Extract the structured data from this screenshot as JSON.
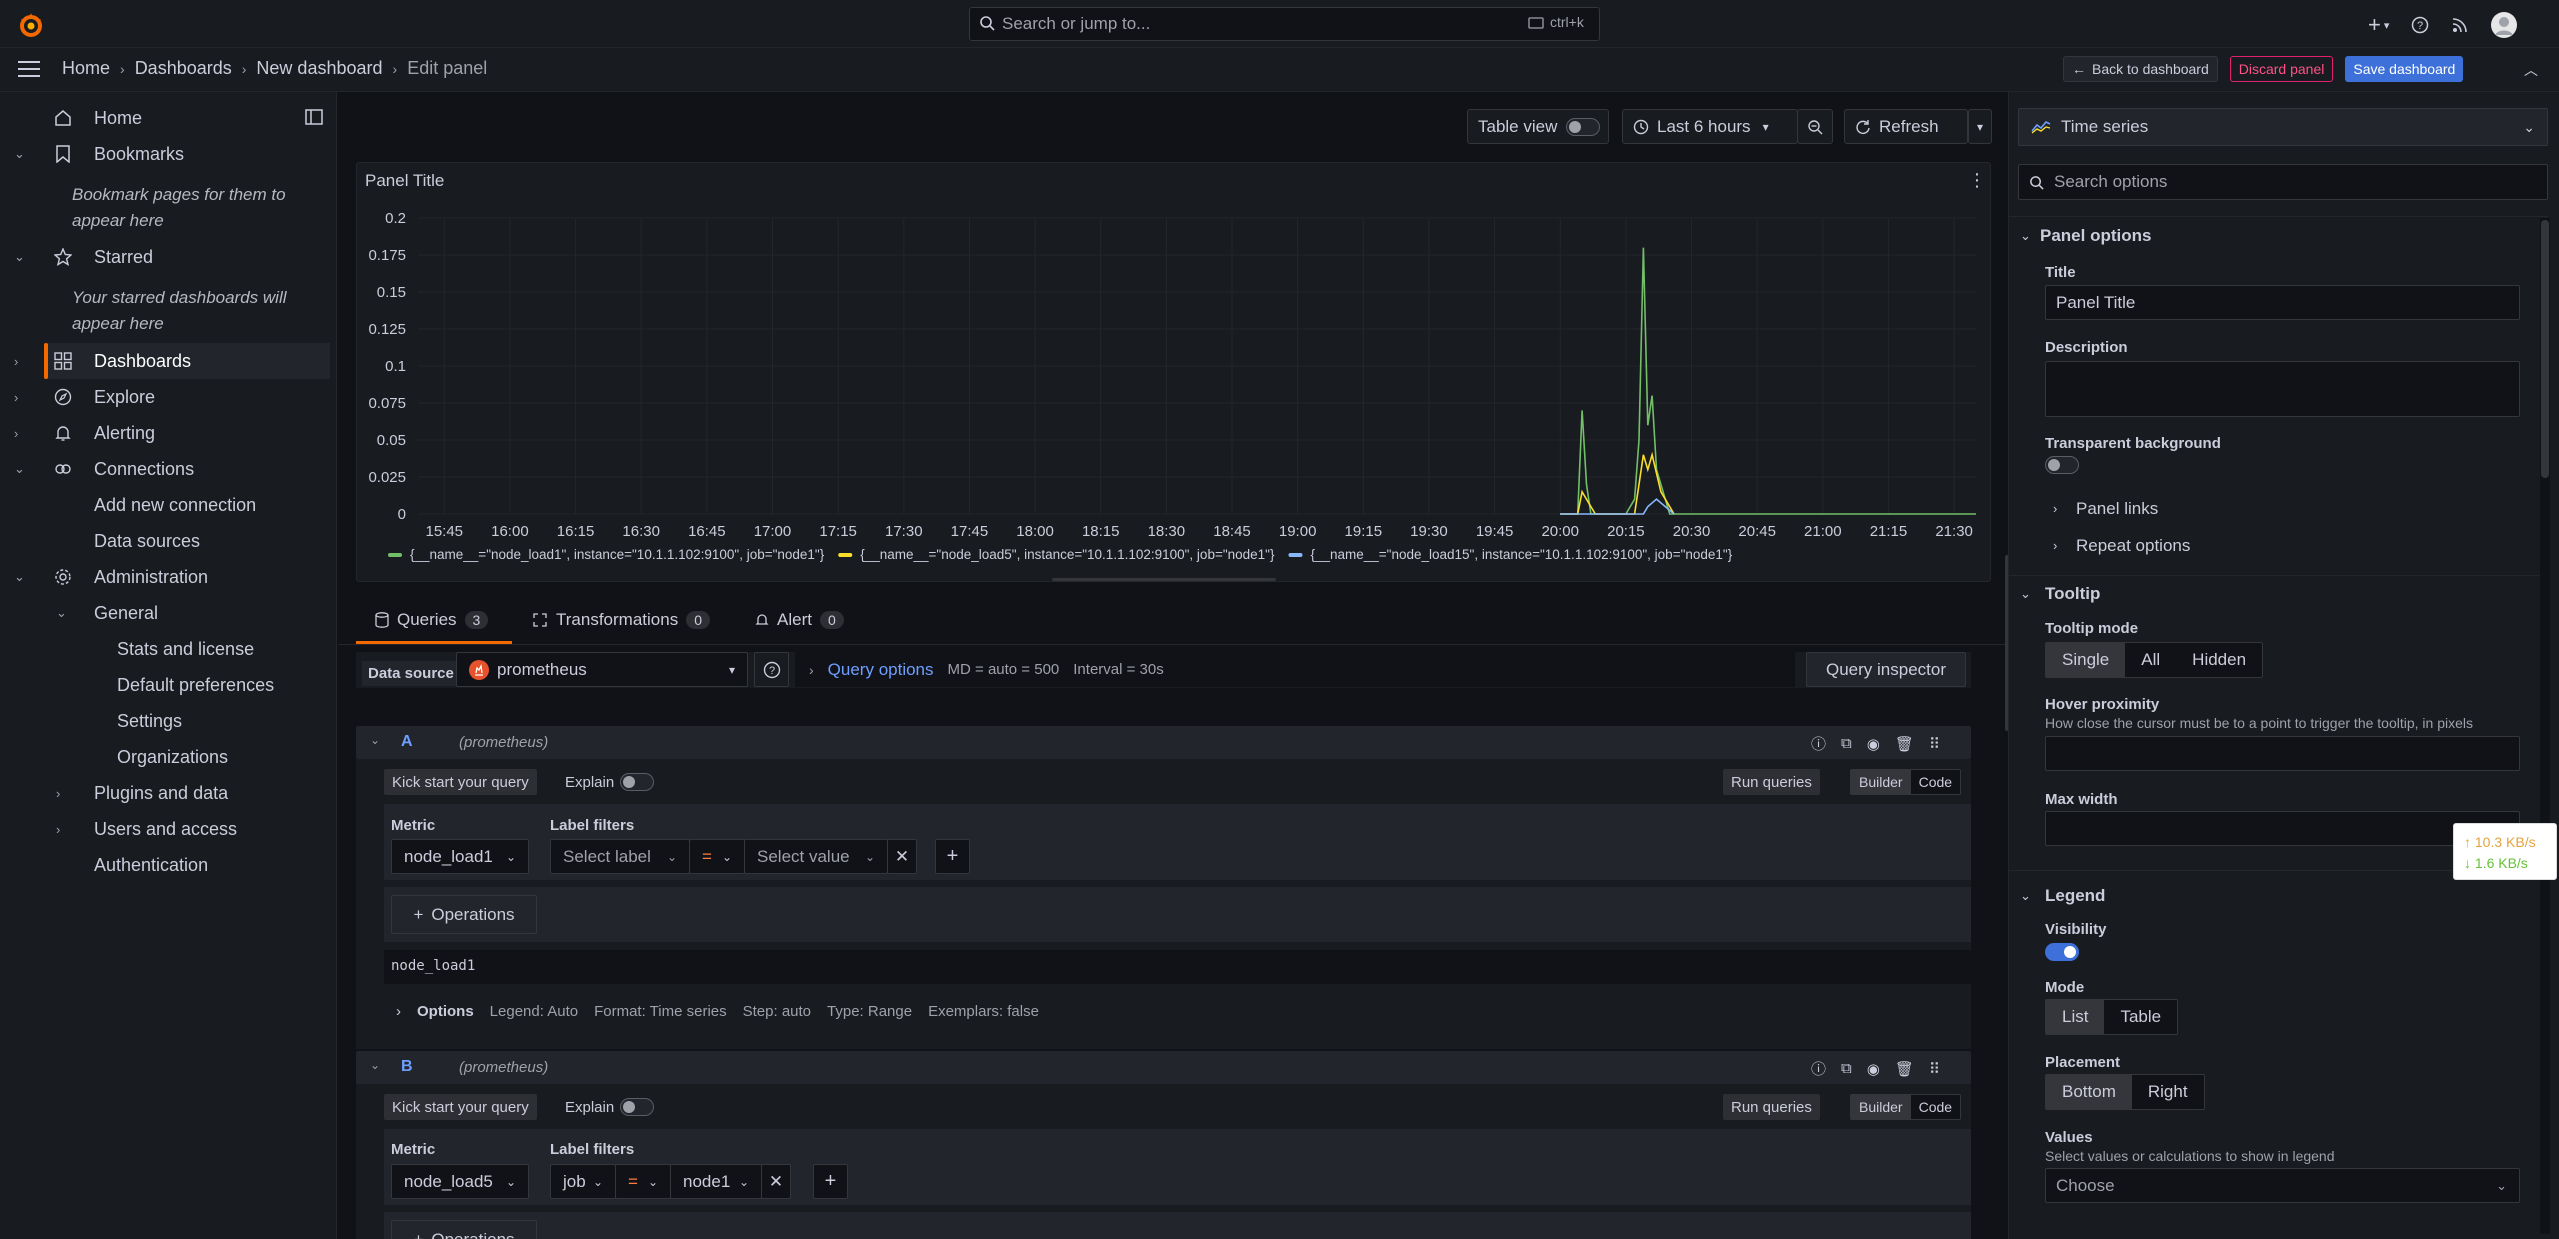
{
  "topbar": {
    "search_placeholder": "Search or jump to...",
    "search_shortcut": "ctrl+k"
  },
  "breadcrumbs": [
    "Home",
    "Dashboards",
    "New dashboard",
    "Edit panel"
  ],
  "actions": {
    "back": "Back to dashboard",
    "discard": "Discard panel",
    "save": "Save dashboard"
  },
  "sidebar": {
    "home": "Home",
    "bookmarks": "Bookmarks",
    "bookmarks_hint_1": "Bookmark pages for them to",
    "bookmarks_hint_2": "appear here",
    "starred": "Starred",
    "starred_hint_1": "Your starred dashboards will",
    "starred_hint_2": "appear here",
    "dashboards": "Dashboards",
    "explore": "Explore",
    "alerting": "Alerting",
    "connections": "Connections",
    "add_connection": "Add new connection",
    "data_sources": "Data sources",
    "administration": "Administration",
    "general": "General",
    "stats": "Stats and license",
    "default_prefs": "Default preferences",
    "settings": "Settings",
    "organizations": "Organizations",
    "plugins": "Plugins and data",
    "users": "Users and access",
    "authentication": "Authentication"
  },
  "panel_toolbar": {
    "table_view": "Table view",
    "time_range": "Last 6 hours",
    "refresh": "Refresh"
  },
  "panel": {
    "title": "Panel Title"
  },
  "chart_data": {
    "type": "line",
    "title": "Panel Title",
    "y_ticks": [
      "0.2",
      "0.175",
      "0.15",
      "0.125",
      "0.1",
      "0.075",
      "0.05",
      "0.025",
      "0"
    ],
    "x_ticks": [
      "15:45",
      "16:00",
      "16:15",
      "16:30",
      "16:45",
      "17:00",
      "17:15",
      "17:30",
      "17:45",
      "18:00",
      "18:15",
      "18:30",
      "18:45",
      "19:00",
      "19:15",
      "19:30",
      "19:45",
      "20:00",
      "20:15",
      "20:30",
      "20:45",
      "21:00",
      "21:15",
      "21:30"
    ],
    "ylim": [
      0,
      0.2
    ],
    "grid": true,
    "legend_placement": "bottom",
    "series": [
      {
        "name": "{__name__=\"node_load1\", instance=\"10.1.1.102:9100\", job=\"node1\"}",
        "color": "#73bf69",
        "points": [
          [
            "20:00",
            0
          ],
          [
            "20:04",
            0
          ],
          [
            "20:05",
            0.07
          ],
          [
            "20:06",
            0.02
          ],
          [
            "20:07",
            0
          ],
          [
            "20:15",
            0
          ],
          [
            "20:17",
            0.01
          ],
          [
            "20:18",
            0.05
          ],
          [
            "20:19",
            0.18
          ],
          [
            "20:20",
            0.06
          ],
          [
            "20:21",
            0.08
          ],
          [
            "20:22",
            0.03
          ],
          [
            "20:24",
            0.01
          ],
          [
            "20:25",
            0
          ],
          [
            "21:35",
            0
          ]
        ]
      },
      {
        "name": "{__name__=\"node_load5\", instance=\"10.1.1.102:9100\", job=\"node1\"}",
        "color": "#fade2a",
        "points": [
          [
            "20:00",
            0
          ],
          [
            "20:04",
            0
          ],
          [
            "20:05",
            0.015
          ],
          [
            "20:07",
            0.005
          ],
          [
            "20:08",
            0
          ],
          [
            "20:17",
            0
          ],
          [
            "20:18",
            0.02
          ],
          [
            "20:19",
            0.04
          ],
          [
            "20:20",
            0.03
          ],
          [
            "20:21",
            0.04
          ],
          [
            "20:23",
            0.015
          ],
          [
            "20:25",
            0.005
          ],
          [
            "20:26",
            0
          ]
        ]
      },
      {
        "name": "{__name__=\"node_load15\", instance=\"10.1.1.102:9100\", job=\"node1\"}",
        "color": "#8ab8ff",
        "points": [
          [
            "20:00",
            0
          ],
          [
            "20:19",
            0
          ],
          [
            "20:20",
            0.005
          ],
          [
            "20:22",
            0.01
          ],
          [
            "20:24",
            0.005
          ],
          [
            "20:26",
            0
          ]
        ]
      }
    ]
  },
  "tabs": {
    "queries": "Queries",
    "queries_count": "3",
    "transformations": "Transformations",
    "transformations_count": "0",
    "alert": "Alert",
    "alert_count": "0"
  },
  "datasource": {
    "label": "Data source",
    "value": "prometheus",
    "query_options": "Query options",
    "md": "MD = auto = 500",
    "interval": "Interval = 30s",
    "inspector": "Query inspector"
  },
  "query_a": {
    "letter": "A",
    "source": "(prometheus)",
    "kick_start": "Kick start your query",
    "explain": "Explain",
    "run": "Run queries",
    "builder": "Builder",
    "code": "Code",
    "metric_label": "Metric",
    "metric": "node_load1",
    "filters_label": "Label filters",
    "select_label": "Select label",
    "op": "=",
    "select_value": "Select value",
    "operations": "Operations",
    "preview": "node_load1",
    "options": "Options",
    "legend": "Legend: Auto",
    "format": "Format: Time series",
    "step": "Step: auto",
    "qtype": "Type: Range",
    "exemplars": "Exemplars: false"
  },
  "query_b": {
    "letter": "B",
    "source": "(prometheus)",
    "kick_start": "Kick start your query",
    "explain": "Explain",
    "run": "Run queries",
    "builder": "Builder",
    "code": "Code",
    "metric_label": "Metric",
    "metric": "node_load5",
    "filters_label": "Label filters",
    "label_key": "job",
    "op": "=",
    "label_value": "node1",
    "operations": "Operations"
  },
  "options_pane": {
    "viz": "Time series",
    "search_placeholder": "Search options",
    "panel_options": "Panel options",
    "title_label": "Title",
    "title_value": "Panel Title",
    "description_label": "Description",
    "transparent_label": "Transparent background",
    "panel_links": "Panel links",
    "repeat_options": "Repeat options",
    "tooltip": "Tooltip",
    "tooltip_mode": "Tooltip mode",
    "mode_single": "Single",
    "mode_all": "All",
    "mode_hidden": "Hidden",
    "hover_proximity": "Hover proximity",
    "hover_desc": "How close the cursor must be to a point to trigger the tooltip, in pixels",
    "max_width": "Max width",
    "legend": "Legend",
    "visibility": "Visibility",
    "mode": "Mode",
    "mode_list": "List",
    "mode_table": "Table",
    "placement": "Placement",
    "place_bottom": "Bottom",
    "place_right": "Right",
    "values": "Values",
    "values_desc": "Select values or calculations to show in legend",
    "choose": "Choose"
  },
  "net_widget": {
    "up": "↑ 10.3 KB/s",
    "down": "↓ 1.6 KB/s"
  }
}
